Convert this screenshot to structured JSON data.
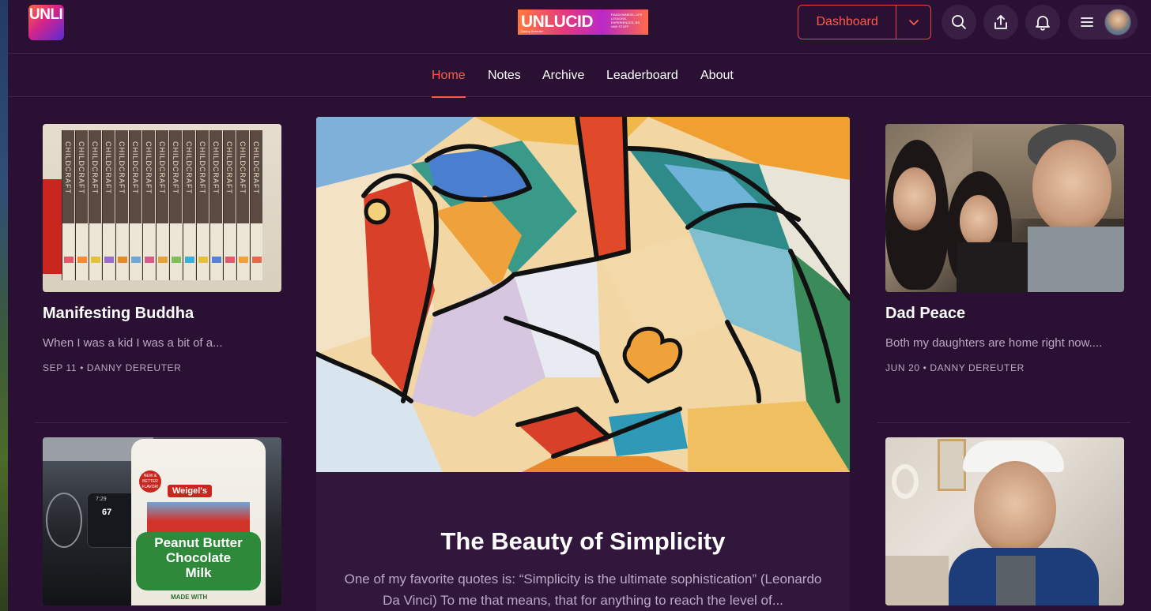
{
  "header": {
    "publication_logo_text": "UNLI",
    "wordmark": {
      "title": "UNLUCID",
      "subtitle": "Danny Dereuter",
      "tagline": "RANDOMNESS, LIFE LESSONS, EXPERIENCES, BS AND STUFF"
    },
    "dashboard_label": "Dashboard",
    "icons": [
      "search-icon",
      "share-icon",
      "bell-icon",
      "menu-icon"
    ]
  },
  "nav": {
    "items": [
      {
        "label": "Home",
        "active": true
      },
      {
        "label": "Notes",
        "active": false
      },
      {
        "label": "Archive",
        "active": false
      },
      {
        "label": "Leaderboard",
        "active": false
      },
      {
        "label": "About",
        "active": false
      }
    ]
  },
  "posts": {
    "left_top": {
      "title": "Manifesting Buddha",
      "excerpt": "When I was a kid I was a bit of a...",
      "date": "SEP 11",
      "author": "DANNY DEREUTER",
      "image_text": "CHILDCRAFT"
    },
    "right_top": {
      "title": "Dad Peace",
      "excerpt": "Both my daughters are home right now....",
      "date": "JUN 20",
      "author": "DANNY DEREUTER"
    },
    "left_bottom": {
      "image_text": {
        "brand": "Weigel's",
        "line1": "Peanut Butter",
        "line2": "Chocolate",
        "line3": "Milk",
        "footer": "MADE WITH",
        "badge": "NEW & BETTER FLAVOR!",
        "dash_time": "7:29",
        "dash_temp": "67"
      }
    },
    "featured": {
      "title": "The Beauty of Simplicity",
      "excerpt": "One of my favorite quotes is: “Simplicity is the ultimate sophistication” (Leonardo Da Vinci) To me that means, that for anything to reach the level of..."
    }
  },
  "colors": {
    "background": "#2a1133",
    "accent": "#ff5a48",
    "muted_text": "#b9a9c2"
  }
}
